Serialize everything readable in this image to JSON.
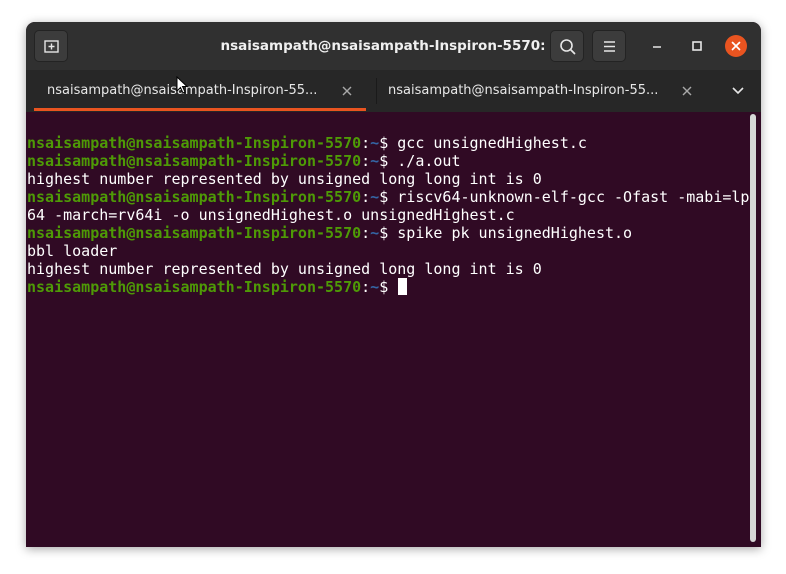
{
  "window": {
    "title": "nsaisampath@nsaisampath-Inspiron-5570: ~"
  },
  "header": {
    "new_tab_icon": "new-tab-icon",
    "search_icon": "search-icon",
    "menu_icon": "hamburger-menu-icon",
    "minimize_icon": "minimize-icon",
    "maximize_icon": "maximize-icon",
    "close_icon": "close-icon"
  },
  "tabs": [
    {
      "label": "nsaisampath@nsaisampath-Inspiron-55...",
      "active": true
    },
    {
      "label": "nsaisampath@nsaisampath-Inspiron-55...",
      "active": false
    }
  ],
  "colors": {
    "background": "#300a24",
    "prompt_user": "#4e9a06",
    "prompt_path": "#3465a4",
    "accent": "#e95420"
  },
  "terminal": {
    "prompt_user": "nsaisampath@nsaisampath-Inspiron-5570",
    "prompt_sep": ":",
    "prompt_path": "~",
    "prompt_symbol": "$ ",
    "lines": [
      {
        "kind": "prompt",
        "command": "gcc unsignedHighest.c"
      },
      {
        "kind": "prompt",
        "command": "./a.out"
      },
      {
        "kind": "output",
        "text": "highest number represented by unsigned long long int is 0"
      },
      {
        "kind": "prompt",
        "command": "riscv64-unknown-elf-gcc -Ofast -mabi=lp"
      },
      {
        "kind": "output",
        "text": "64 -march=rv64i -o unsignedHighest.o unsignedHighest.c"
      },
      {
        "kind": "prompt",
        "command": "spike pk unsignedHighest.o"
      },
      {
        "kind": "output",
        "text": "bbl loader"
      },
      {
        "kind": "output",
        "text": "highest number represented by unsigned long long int is 0"
      },
      {
        "kind": "prompt",
        "command": ""
      }
    ]
  }
}
